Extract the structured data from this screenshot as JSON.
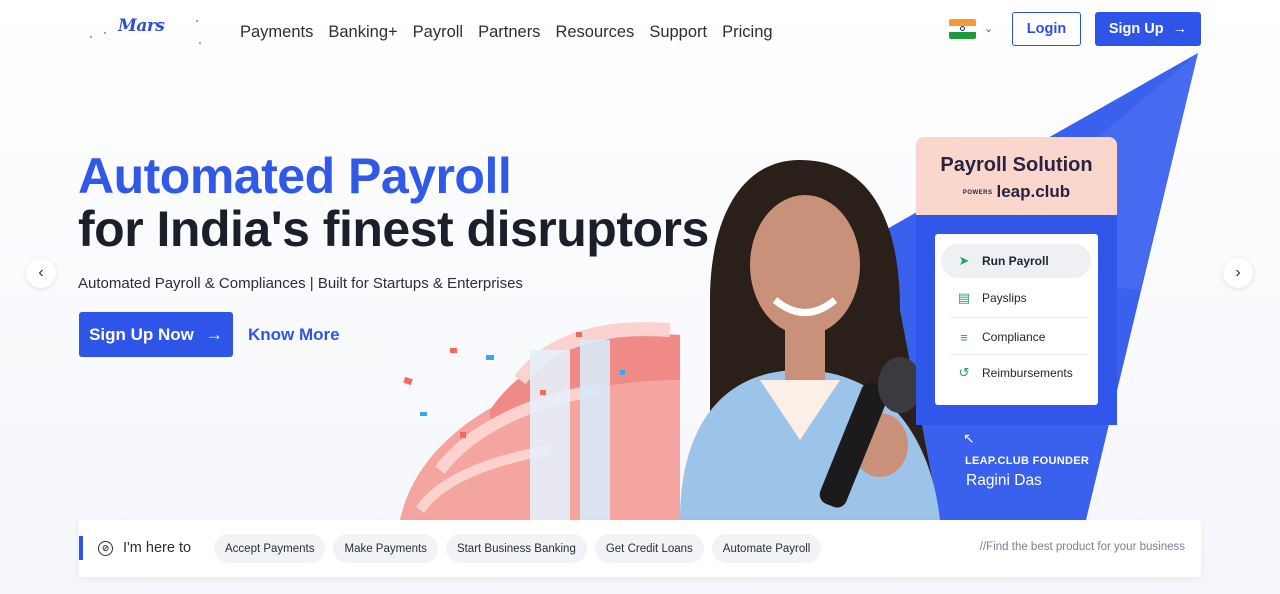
{
  "brand": {
    "logo_text": "Mars"
  },
  "nav": {
    "items": [
      "Payments",
      "Banking+",
      "Payroll",
      "Partners",
      "Resources",
      "Support",
      "Pricing"
    ]
  },
  "header": {
    "login_label": "Login",
    "signup_label": "Sign Up",
    "arrow": "→",
    "chevron": "⌄"
  },
  "hero": {
    "title_line1": "Automated Payroll",
    "title_line2": "for India's finest disruptors",
    "subtitle": "Automated Payroll & Compliances | Built for Startups & Enterprises",
    "cta_label": "Sign Up Now",
    "cta_arrow": "→",
    "know_more_label": "Know More"
  },
  "carousel": {
    "prev": "‹",
    "next": "›"
  },
  "illustration": {
    "solution_title": "Payroll Solution",
    "powers_label": "POWERS",
    "powers_brand": "leap.club",
    "menu_items": [
      "Run Payroll",
      "Payslips",
      "Compliance",
      "Reimbursements"
    ],
    "founder_arrow": "↖",
    "founder_label": "LEAP.CLUB FOUNDER",
    "founder_name": "Ragini Das"
  },
  "bottom_bar": {
    "here_icon": "⊘",
    "here_label": "I'm here to",
    "chips": [
      "Accept Payments",
      "Make Payments",
      "Start Business Banking",
      "Get Credit Loans",
      "Automate Payroll"
    ],
    "find_text": "//Find the best product for your business"
  },
  "colors": {
    "brand_blue": "#2f55e8",
    "title_blue": "#2f59e6",
    "accent_salmon": "#fbd6cc",
    "success_green": "#27a06a"
  }
}
